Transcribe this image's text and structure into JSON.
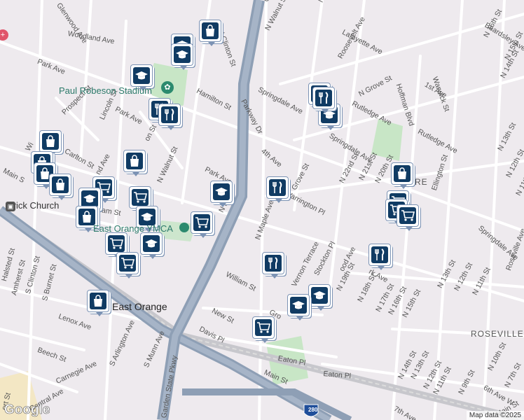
{
  "map": {
    "credits": "Map data ©2025",
    "logo": "Google",
    "colors": {
      "background": "#eeeaee",
      "park": "#c8e6c6",
      "highway": "#8e9fb5",
      "road": "#ffffff",
      "pin_fill": "#103b63"
    },
    "street_labels": [
      {
        "text": "Glenwood Ave"
      },
      {
        "text": "Woodland Ave"
      },
      {
        "text": "N Clinton St"
      },
      {
        "text": "Park Ave"
      },
      {
        "text": "Prospect St"
      },
      {
        "text": "Lincoln St"
      },
      {
        "text": "Hamilton St"
      },
      {
        "text": "Park Ave"
      },
      {
        "text": "Carlton St"
      },
      {
        "text": "N Walnut St"
      },
      {
        "text": "Halsted St"
      },
      {
        "text": "Amherst St"
      },
      {
        "text": "S Clinton St"
      },
      {
        "text": "S Burnet St"
      },
      {
        "text": "Lenox Ave"
      },
      {
        "text": "Beech St"
      },
      {
        "text": "Carnegie Ave"
      },
      {
        "text": "Central Ave"
      },
      {
        "text": "S Arlington Ave"
      },
      {
        "text": "S Munn Ave"
      },
      {
        "text": "Garden State Pkwy"
      },
      {
        "text": "Garden"
      },
      {
        "text": "N Walnut St"
      },
      {
        "text": "Parkway Dr"
      },
      {
        "text": "Springdale Ave"
      },
      {
        "text": "4th Ave"
      },
      {
        "text": "Grove St"
      },
      {
        "text": "Roosevelt Ave"
      },
      {
        "text": "Lafayette Ave"
      },
      {
        "text": "N Grove St"
      },
      {
        "text": "Rutledge Ave"
      },
      {
        "text": "Springdale Ave"
      },
      {
        "text": "Hoffman Blvd"
      },
      {
        "text": "Warwick St"
      },
      {
        "text": "1st Ave"
      },
      {
        "text": "Beardsley Ave"
      },
      {
        "text": "N 16th St"
      },
      {
        "text": "N 15th St"
      },
      {
        "text": "N 14th St"
      },
      {
        "text": "N 13th St"
      },
      {
        "text": "N 22nd St"
      },
      {
        "text": "N 21st St"
      },
      {
        "text": "N 20th St"
      },
      {
        "text": "Rutledge Ave"
      },
      {
        "text": "Ellington St"
      },
      {
        "text": "N 12th St"
      },
      {
        "text": "N 11th St"
      },
      {
        "text": "Warrington Pl"
      },
      {
        "text": "N Maple Ave"
      },
      {
        "text": "William St"
      },
      {
        "text": "Vernon Terrace"
      },
      {
        "text": "Stockton Pl"
      },
      {
        "text": "N 19th St"
      },
      {
        "text": "N 18th St"
      },
      {
        "text": "N 17th St"
      },
      {
        "text": "N 16th St"
      },
      {
        "text": "N 15th St"
      },
      {
        "text": "N 13th St"
      },
      {
        "text": "N 12th St"
      },
      {
        "text": "N 11th St"
      },
      {
        "text": "Springdale Ave"
      },
      {
        "text": "Roseville Ave"
      },
      {
        "text": "New St"
      },
      {
        "text": "Davis Pl"
      },
      {
        "text": "Eaton Pl"
      },
      {
        "text": "Eaton Pl"
      },
      {
        "text": "Main St"
      },
      {
        "text": "N 14th St"
      },
      {
        "text": "N 13th St"
      },
      {
        "text": "N 12th St"
      },
      {
        "text": "N 11th St"
      },
      {
        "text": "N 9th St"
      },
      {
        "text": "N 10th St"
      },
      {
        "text": "N 7th St"
      },
      {
        "text": "6th Ave W"
      },
      {
        "text": "7th Ave"
      },
      {
        "text": "Main St"
      },
      {
        "text": "rk Ave"
      },
      {
        "text": "Park Ave"
      },
      {
        "text": "Wi"
      },
      {
        "text": "Main S"
      },
      {
        "text": "Gro"
      },
      {
        "text": "ood Ave"
      },
      {
        "text": "N A"
      },
      {
        "text": "ort St"
      },
      {
        "text": "nd Ave"
      },
      {
        "text": "N Mu"
      },
      {
        "text": "iam St"
      },
      {
        "text": "on St"
      }
    ],
    "place_labels": [
      {
        "text": "Paul Robeson Stadium"
      },
      {
        "text": "Brick Church"
      },
      {
        "text": "East Orange YMCA"
      },
      {
        "text": "East Orange"
      },
      {
        "text": "ROSEVILLE"
      },
      {
        "text": "RE"
      }
    ],
    "highway_shields": [
      {
        "text": "280"
      }
    ],
    "pins": [
      {
        "type": "shopping"
      },
      {
        "type": "school"
      },
      {
        "type": "school"
      },
      {
        "type": "school"
      },
      {
        "type": "dining"
      },
      {
        "type": "dining"
      },
      {
        "type": "shopping"
      },
      {
        "type": "shopping"
      },
      {
        "type": "shopping"
      },
      {
        "type": "shopping"
      },
      {
        "type": "grocery"
      },
      {
        "type": "grocery"
      },
      {
        "type": "school"
      },
      {
        "type": "shopping"
      },
      {
        "type": "school"
      },
      {
        "type": "grocery"
      },
      {
        "type": "school"
      },
      {
        "type": "grocery"
      },
      {
        "type": "grocery"
      },
      {
        "type": "school"
      },
      {
        "type": "shopping"
      },
      {
        "type": "shopping"
      },
      {
        "type": "school"
      },
      {
        "type": "dining"
      },
      {
        "type": "dining"
      },
      {
        "type": "school"
      },
      {
        "type": "dining"
      },
      {
        "type": "school"
      },
      {
        "type": "school"
      },
      {
        "type": "grocery"
      },
      {
        "type": "shopping"
      },
      {
        "type": "grocery"
      },
      {
        "type": "grocery"
      },
      {
        "type": "grocery"
      },
      {
        "type": "dining"
      }
    ]
  }
}
